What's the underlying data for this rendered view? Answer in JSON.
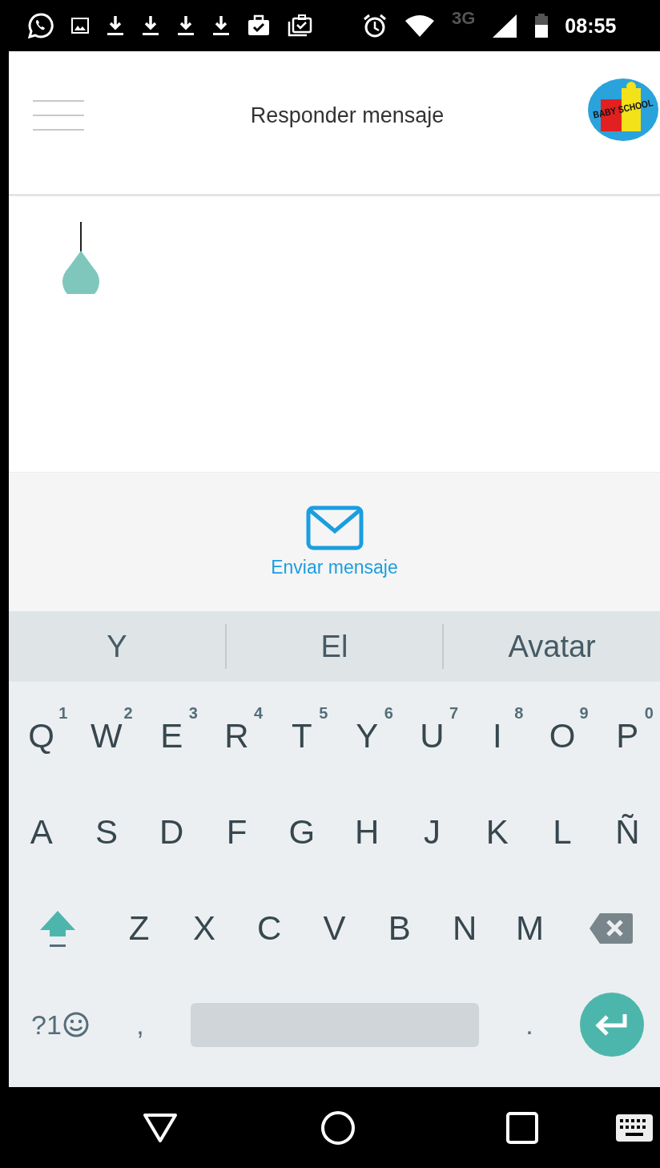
{
  "status_bar": {
    "network": "3G",
    "time": "08:55"
  },
  "header": {
    "title": "Responder mensaje",
    "logo_text": "BABY SCHOOL"
  },
  "send_button": {
    "label": "Enviar mensaje"
  },
  "keyboard": {
    "suggestions": [
      "Y",
      "El",
      "Avatar"
    ],
    "row_1": [
      {
        "label": "Q",
        "hint": "1"
      },
      {
        "label": "W",
        "hint": "2"
      },
      {
        "label": "E",
        "hint": "3"
      },
      {
        "label": "R",
        "hint": "4"
      },
      {
        "label": "T",
        "hint": "5"
      },
      {
        "label": "Y",
        "hint": "6"
      },
      {
        "label": "U",
        "hint": "7"
      },
      {
        "label": "I",
        "hint": "8"
      },
      {
        "label": "O",
        "hint": "9"
      },
      {
        "label": "P",
        "hint": "0"
      }
    ],
    "row_2": [
      "A",
      "S",
      "D",
      "F",
      "G",
      "H",
      "J",
      "K",
      "L",
      "Ñ"
    ],
    "row_3": [
      "Z",
      "X",
      "C",
      "V",
      "B",
      "N",
      "M"
    ],
    "shift": {
      "on": true
    },
    "symbols_key": "?1",
    "comma_key": ",",
    "period_key": "."
  }
}
